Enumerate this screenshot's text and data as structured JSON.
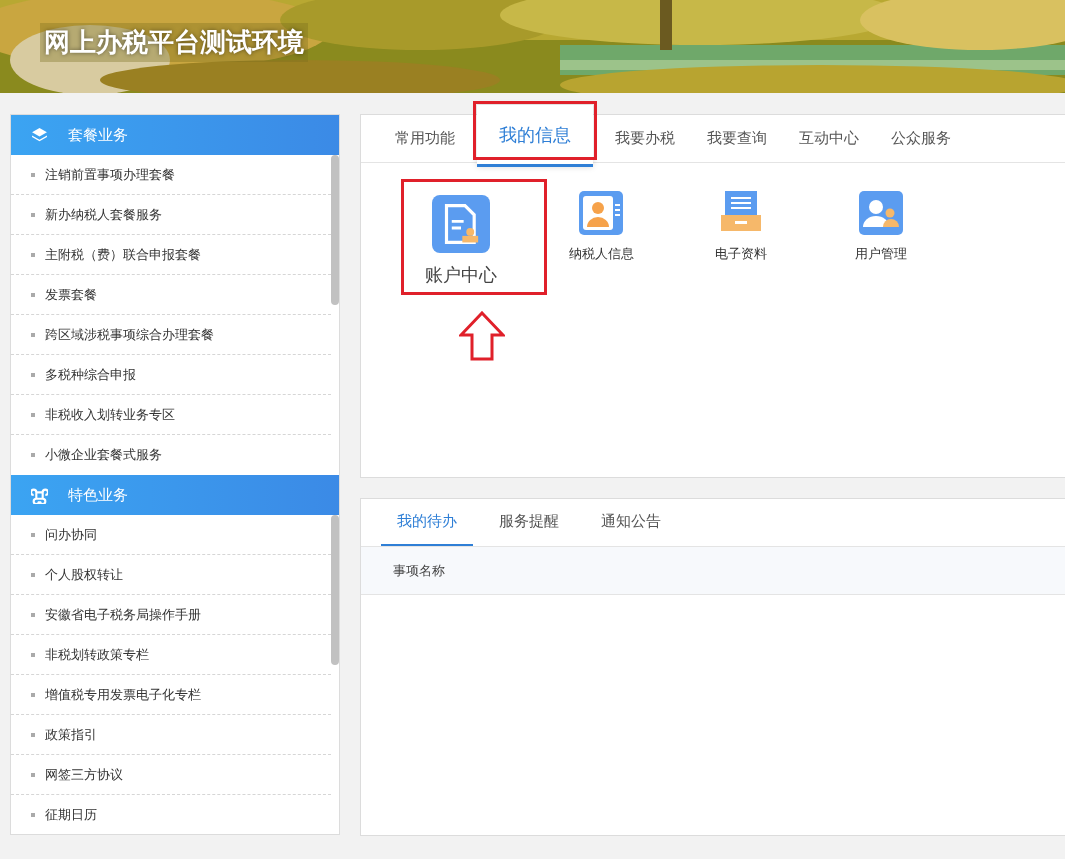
{
  "header": {
    "title": "网上办税平台测试环境"
  },
  "sidebar": {
    "sections": [
      {
        "title": "套餐业务",
        "items": [
          "注销前置事项办理套餐",
          "新办纳税人套餐服务",
          "主附税（费）联合申报套餐",
          "发票套餐",
          "跨区域涉税事项综合办理套餐",
          "多税种综合申报",
          "非税收入划转业务专区",
          "小微企业套餐式服务"
        ]
      },
      {
        "title": "特色业务",
        "items": [
          "问办协同",
          "个人股权转让",
          "安徽省电子税务局操作手册",
          "非税划转政策专栏",
          "增值税专用发票电子化专栏",
          "政策指引",
          "网签三方协议",
          "征期日历"
        ]
      }
    ]
  },
  "top_panel": {
    "tabs": [
      {
        "label": "常用功能",
        "selected": false
      },
      {
        "label": "我的信息",
        "selected": true
      },
      {
        "label": "我要办税",
        "selected": false
      },
      {
        "label": "我要查询",
        "selected": false
      },
      {
        "label": "互动中心",
        "selected": false
      },
      {
        "label": "公众服务",
        "selected": false
      }
    ],
    "items": [
      {
        "label": "账户中心",
        "highlighted": true
      },
      {
        "label": "纳税人信息",
        "highlighted": false
      },
      {
        "label": "电子资料",
        "highlighted": false
      },
      {
        "label": "用户管理",
        "highlighted": false
      }
    ]
  },
  "bottom_panel": {
    "tabs": [
      {
        "label": "我的待办",
        "selected": true
      },
      {
        "label": "服务提醒",
        "selected": false
      },
      {
        "label": "通知公告",
        "selected": false
      }
    ],
    "table": {
      "columns": [
        "事项名称"
      ]
    }
  }
}
